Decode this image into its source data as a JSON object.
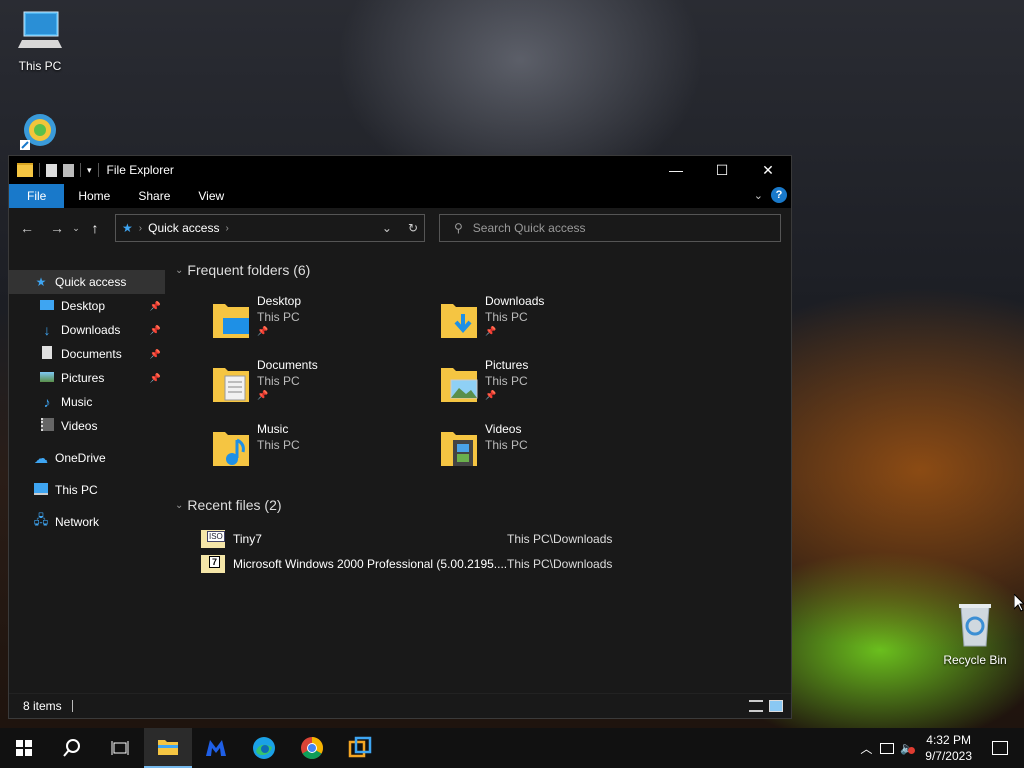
{
  "desktop": {
    "icons": [
      {
        "label": "This PC"
      },
      {
        "label": ""
      },
      {
        "label": "Recycle Bin"
      }
    ]
  },
  "window": {
    "title": "File Explorer",
    "ribbon_tabs": [
      "File",
      "Home",
      "Share",
      "View"
    ],
    "address": {
      "crumb": "Quick access"
    },
    "search": {
      "placeholder": "Search Quick access"
    },
    "sidebar": [
      {
        "label": "Quick access",
        "icon": "star-icon",
        "selected": true
      },
      {
        "label": "Desktop",
        "icon": "desktop-folder-icon",
        "pinned": true
      },
      {
        "label": "Downloads",
        "icon": "download-icon",
        "pinned": true
      },
      {
        "label": "Documents",
        "icon": "documents-icon",
        "pinned": true
      },
      {
        "label": "Pictures",
        "icon": "pictures-icon",
        "pinned": true
      },
      {
        "label": "Music",
        "icon": "music-icon"
      },
      {
        "label": "Videos",
        "icon": "videos-icon"
      },
      {
        "label": "OneDrive",
        "icon": "cloud-icon"
      },
      {
        "label": "This PC",
        "icon": "computer-icon"
      },
      {
        "label": "Network",
        "icon": "network-icon"
      }
    ],
    "frequent": {
      "header": "Frequent folders (6)",
      "items": [
        {
          "name": "Desktop",
          "location": "This PC",
          "pinned": true,
          "overlay": "desktop-icon"
        },
        {
          "name": "Downloads",
          "location": "This PC",
          "pinned": true,
          "overlay": "download-icon"
        },
        {
          "name": "Documents",
          "location": "This PC",
          "pinned": true,
          "overlay": "document-icon"
        },
        {
          "name": "Pictures",
          "location": "This PC",
          "pinned": true,
          "overlay": "picture-icon"
        },
        {
          "name": "Music",
          "location": "This PC",
          "pinned": false,
          "overlay": "music-note-icon"
        },
        {
          "name": "Videos",
          "location": "This PC",
          "pinned": false,
          "overlay": "film-icon"
        }
      ]
    },
    "recent": {
      "header": "Recent files (2)",
      "items": [
        {
          "name": "Tiny7",
          "location": "This PC\\Downloads",
          "badge": "ISO"
        },
        {
          "name": "Microsoft Windows 2000 Professional (5.00.2195....",
          "location": "This PC\\Downloads",
          "badge": "7"
        }
      ]
    },
    "status": {
      "items": "8 items"
    }
  },
  "taskbar": {
    "time": "4:32 PM",
    "date": "9/7/2023",
    "apps": [
      "start-icon",
      "search-icon",
      "task-view-icon",
      "file-explorer-icon",
      "malwarebytes-icon",
      "edge-icon",
      "chrome-icon",
      "virtualbox-icon"
    ]
  },
  "colors": {
    "accent": "#1979ca",
    "folder": "#f5c542"
  }
}
